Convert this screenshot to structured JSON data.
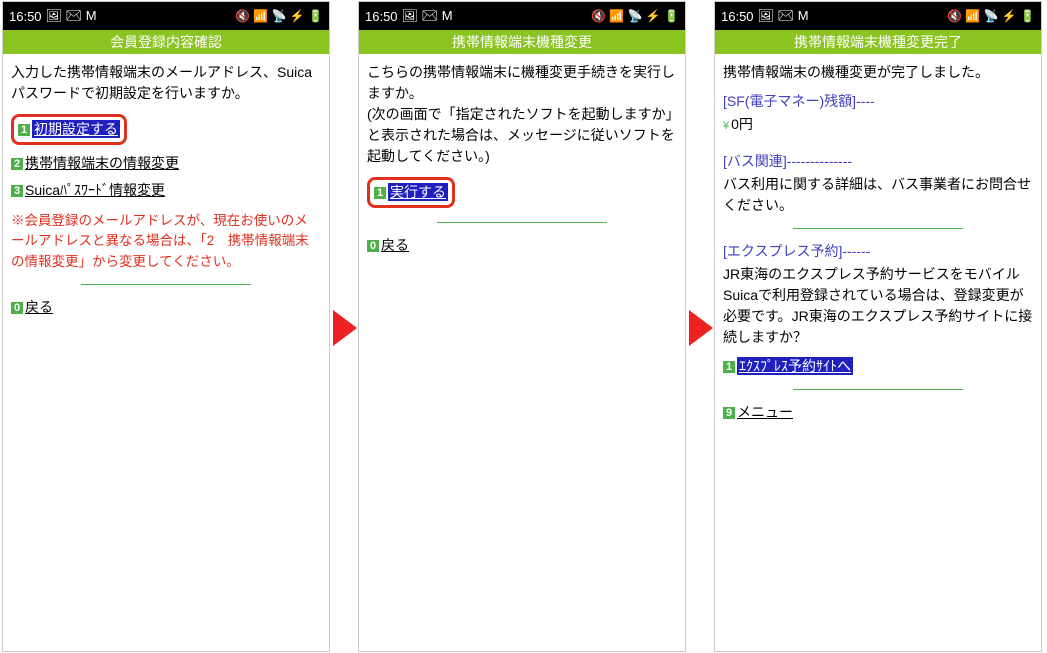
{
  "status": {
    "time": "16:50",
    "icons_left": "🖼 ✉ M",
    "icons_right": "🔇 📶 📡 ⚡ 🔋"
  },
  "screen1": {
    "title": "会員登録内容確認",
    "intro": "入力した携帯情報端末のメールアドレス、Suicaパスワードで初期設定を行いますか。",
    "links": {
      "l1": "初期設定する",
      "l2": "携帯情報端末の情報変更",
      "l3": "Suicaﾊﾟｽﾜｰﾄﾞ情報変更",
      "back": "戻る"
    },
    "note": "※会員登録のメールアドレスが、現在お使いのメールアドレスと異なる場合は、「2　携帯情報端末の情報変更」から変更してください。"
  },
  "screen2": {
    "title": "携帯情報端末機種変更",
    "intro": "こちらの携帯情報端末に機種変更手続きを実行しますか。\n(次の画面で「指定されたソフトを起動しますか」と表示された場合は、メッセージに従いソフトを起動してください。)",
    "links": {
      "exec": "実行する",
      "back": "戻る"
    }
  },
  "screen3": {
    "title": "携帯情報端末機種変更完了",
    "intro": "携帯情報端末の機種変更が完了しました。",
    "sf_head": "[SF(電子マネー)残額]----",
    "sf_bal": "0円",
    "bus_head": "[バス関連]--------------",
    "bus_text": "バス利用に関する詳細は、バス事業者にお問合せください。",
    "exp_head": "[エクスプレス予約]------",
    "exp_text": "JR東海のエクスプレス予約サービスをモバイルSuicaで利用登録されている場合は、登録変更が必要です。JR東海のエクスプレス予約サイトに接続しますか？",
    "links": {
      "express": "ｴｸｽﾌﾟﾚｽ予約ｻｲﾄへ",
      "menu": "メニュー"
    }
  }
}
